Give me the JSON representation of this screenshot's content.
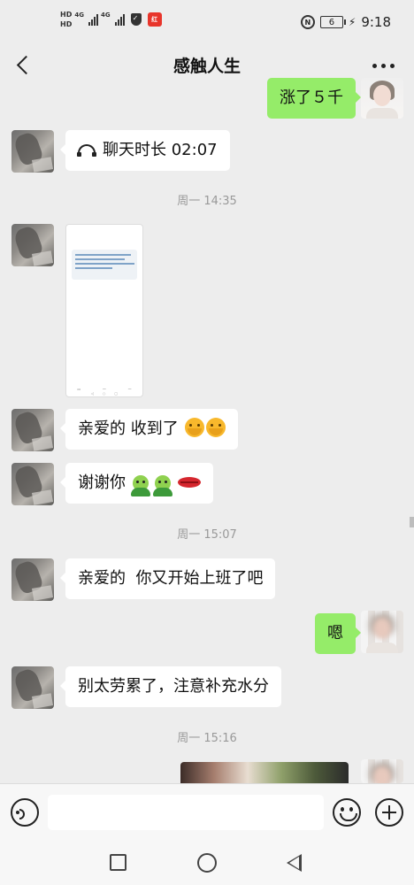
{
  "status_bar": {
    "hd1": "HD",
    "hd2": "HD",
    "net1": "4G",
    "net2": "4G",
    "app_badge": "红",
    "nfc": "N",
    "battery": "6",
    "time": "9:18"
  },
  "header": {
    "title": "感触人生"
  },
  "messages": [
    {
      "side": "right",
      "text": "涨了５千"
    },
    {
      "side": "left",
      "type": "call",
      "text": "聊天时长 02:07"
    },
    {
      "type": "time",
      "text": "周一 14:35"
    },
    {
      "side": "left",
      "type": "image"
    },
    {
      "side": "left",
      "text": "亲爱的 收到了"
    },
    {
      "side": "left",
      "text": "谢谢你"
    },
    {
      "type": "time",
      "text": "周一 15:07"
    },
    {
      "side": "left",
      "text": "亲爱的  你又开始上班了吧"
    },
    {
      "side": "right",
      "text": "嗯"
    },
    {
      "side": "left",
      "text": "别太劳累了，注意补充水分"
    },
    {
      "type": "time",
      "text": "周一 15:16"
    },
    {
      "side": "right",
      "type": "image"
    }
  ],
  "icons": {
    "back": "back-arrow-icon",
    "more": "more-icon",
    "voice": "voice-icon",
    "emoji": "emoji-icon",
    "plus": "plus-icon",
    "call": "call-icon"
  },
  "colors": {
    "background": "#ededed",
    "bubble_left": "#ffffff",
    "bubble_right": "#95ec69",
    "time_label": "#999999"
  }
}
